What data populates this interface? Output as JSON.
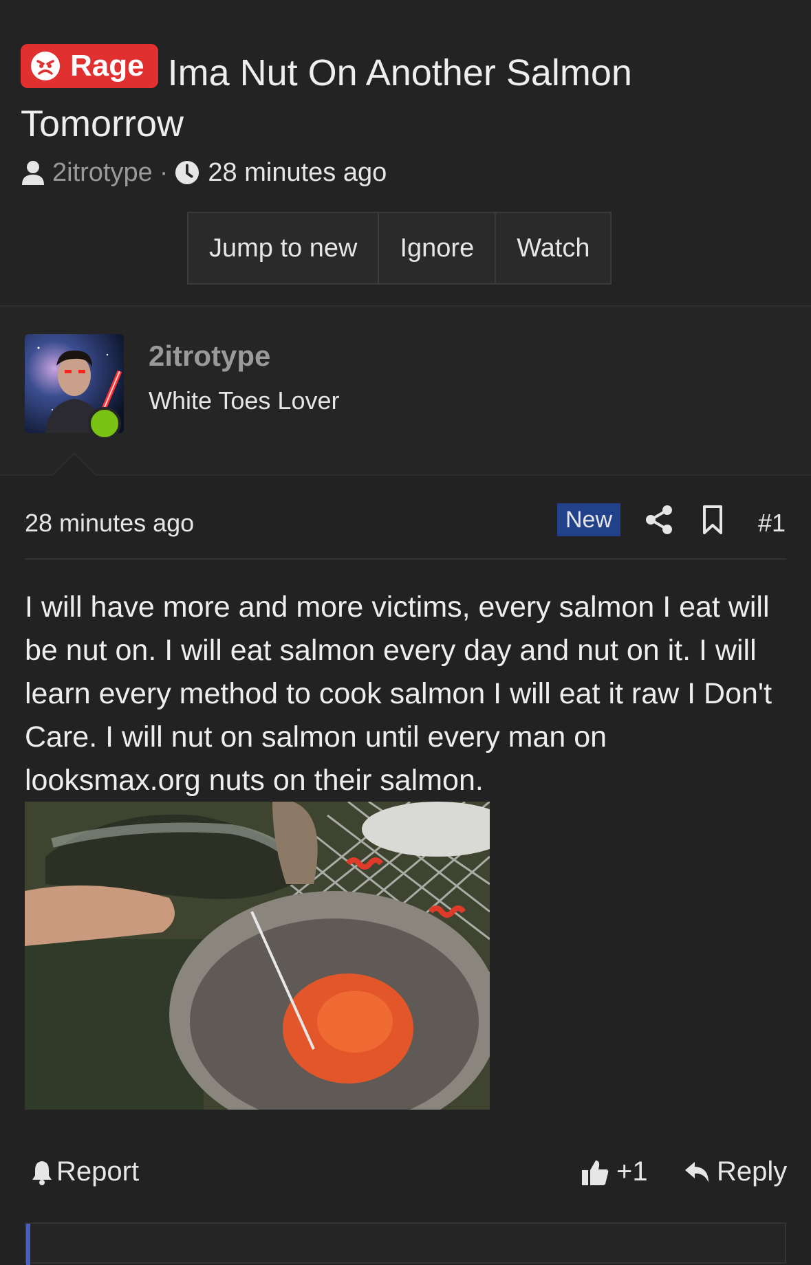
{
  "thread": {
    "prefix": "Rage",
    "title": "Ima Nut On Another Salmon Tomorrow",
    "author": "2itrotype",
    "separator": "·",
    "time": "28 minutes ago",
    "buttons": {
      "jump": "Jump to new",
      "ignore": "Ignore",
      "watch": "Watch"
    },
    "prefix_color": "#e03030"
  },
  "poster": {
    "username": "2itrotype",
    "user_title": "White Toes Lover",
    "online_color": "#7ac214"
  },
  "post": {
    "time": "28 minutes ago",
    "badge": "New",
    "number": "#1",
    "body": "I will have more and more victims, every salmon I eat will be nut on. I will eat salmon every day and nut on it. I will learn every method to cook salmon I will eat it raw I Don't Care. I will nut on salmon until every man on looksmax.org nuts on their salmon.",
    "actions": {
      "report": "Report",
      "like_count": "+1",
      "reply": "Reply"
    },
    "icons": [
      "share-icon",
      "bookmark-icon",
      "bell-icon",
      "thumbs-up-icon",
      "reply-icon"
    ]
  }
}
